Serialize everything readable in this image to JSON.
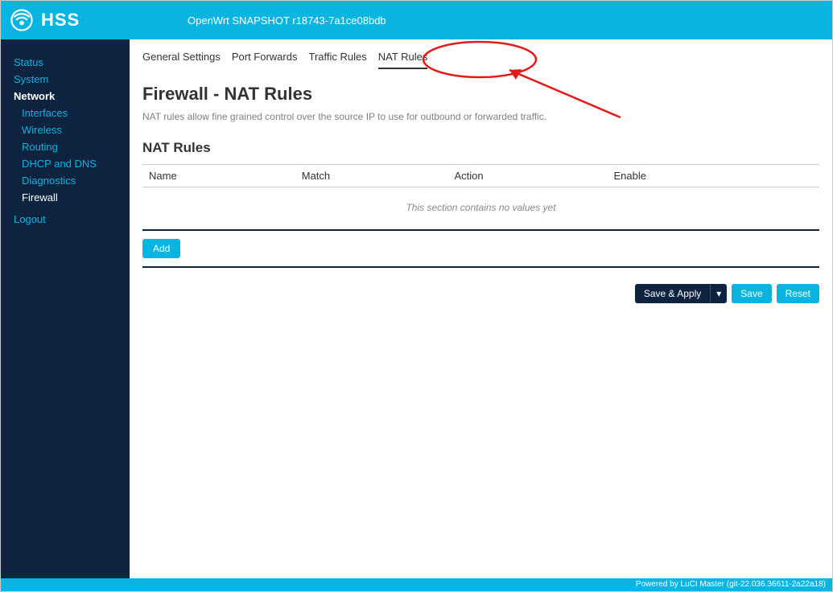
{
  "header": {
    "brand": "HSS",
    "hostname": "OpenWrt SNAPSHOT r18743-7a1ce08bdb"
  },
  "sidebar": {
    "items": [
      {
        "label": "Status",
        "type": "top"
      },
      {
        "label": "System",
        "type": "top"
      },
      {
        "label": "Network",
        "type": "top",
        "active": true
      },
      {
        "label": "Interfaces",
        "type": "sub"
      },
      {
        "label": "Wireless",
        "type": "sub"
      },
      {
        "label": "Routing",
        "type": "sub"
      },
      {
        "label": "DHCP and DNS",
        "type": "sub"
      },
      {
        "label": "Diagnostics",
        "type": "sub"
      },
      {
        "label": "Firewall",
        "type": "sub",
        "active": true
      }
    ],
    "logout": "Logout"
  },
  "tabs": [
    {
      "label": "General Settings"
    },
    {
      "label": "Port Forwards"
    },
    {
      "label": "Traffic Rules"
    },
    {
      "label": "NAT Rules",
      "active": true
    }
  ],
  "page": {
    "title": "Firewall - NAT Rules",
    "description": "NAT rules allow fine grained control over the source IP to use for outbound or forwarded traffic.",
    "section_title": "NAT Rules",
    "columns": {
      "name": "Name",
      "match": "Match",
      "action": "Action",
      "enable": "Enable"
    },
    "empty_text": "This section contains no values yet",
    "add_label": "Add"
  },
  "actions": {
    "save_apply": "Save & Apply",
    "dropdown_glyph": "▾",
    "save": "Save",
    "reset": "Reset"
  },
  "footer": {
    "text": "Powered by LuCI Master (git-22.036.36611-2a22a18)"
  }
}
